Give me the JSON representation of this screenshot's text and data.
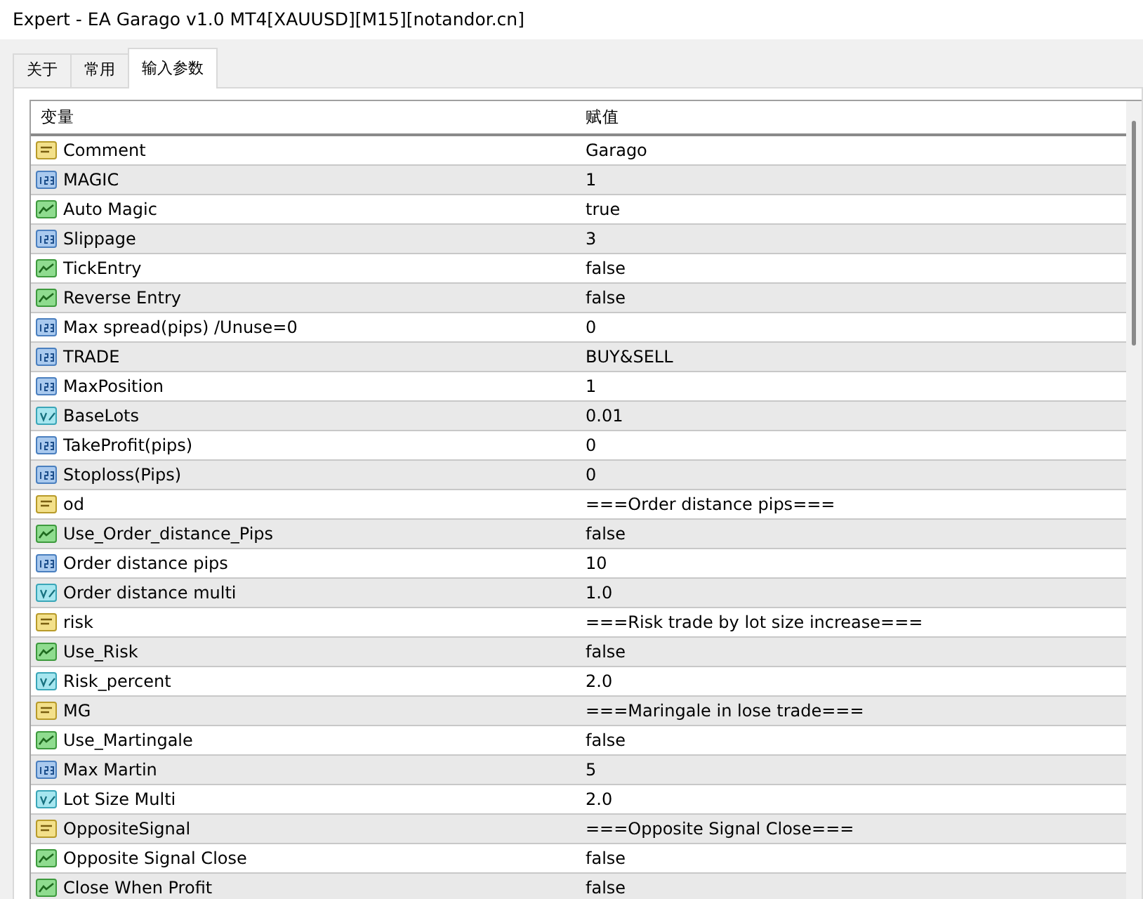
{
  "window": {
    "title": "Expert - EA Garago v1.0 MT4[XAUUSD][M15][notandor.cn]"
  },
  "tabs": [
    {
      "label": "关于",
      "selected": false
    },
    {
      "label": "常用",
      "selected": false
    },
    {
      "label": "输入参数",
      "selected": true
    }
  ],
  "table": {
    "columns": [
      "变量",
      "赋值"
    ],
    "rows": [
      {
        "kind": "string",
        "name": "Comment",
        "value": "Garago"
      },
      {
        "kind": "int",
        "name": "MAGIC",
        "value": "1"
      },
      {
        "kind": "bool",
        "name": "Auto Magic",
        "value": "true"
      },
      {
        "kind": "int",
        "name": "Slippage",
        "value": "3"
      },
      {
        "kind": "bool",
        "name": "TickEntry",
        "value": "false"
      },
      {
        "kind": "bool",
        "name": "Reverse Entry",
        "value": "false"
      },
      {
        "kind": "int",
        "name": "Max spread(pips) /Unuse=0",
        "value": "0"
      },
      {
        "kind": "int",
        "name": "TRADE",
        "value": "BUY&SELL"
      },
      {
        "kind": "int",
        "name": "MaxPosition",
        "value": "1"
      },
      {
        "kind": "double",
        "name": "BaseLots",
        "value": "0.01"
      },
      {
        "kind": "int",
        "name": "TakeProfit(pips)",
        "value": "0"
      },
      {
        "kind": "int",
        "name": "Stoploss(Pips)",
        "value": "0"
      },
      {
        "kind": "string",
        "name": "od",
        "value": "===Order distance pips==="
      },
      {
        "kind": "bool",
        "name": "Use_Order_distance_Pips",
        "value": "false"
      },
      {
        "kind": "int",
        "name": "Order distance pips",
        "value": "10"
      },
      {
        "kind": "double",
        "name": "Order distance multi",
        "value": "1.0"
      },
      {
        "kind": "string",
        "name": "risk",
        "value": "===Risk trade by lot size increase==="
      },
      {
        "kind": "bool",
        "name": "Use_Risk",
        "value": "false"
      },
      {
        "kind": "double",
        "name": "Risk_percent",
        "value": "2.0"
      },
      {
        "kind": "string",
        "name": "MG",
        "value": "===Maringale in lose trade==="
      },
      {
        "kind": "bool",
        "name": "Use_Martingale",
        "value": "false"
      },
      {
        "kind": "int",
        "name": "Max Martin",
        "value": "5"
      },
      {
        "kind": "double",
        "name": "Lot Size Multi",
        "value": "2.0"
      },
      {
        "kind": "string",
        "name": "OppositeSignal",
        "value": "===Opposite Signal Close==="
      },
      {
        "kind": "bool",
        "name": "Opposite Signal Close",
        "value": "false"
      },
      {
        "kind": "bool",
        "name": "Close When Profit",
        "value": "false"
      }
    ]
  }
}
